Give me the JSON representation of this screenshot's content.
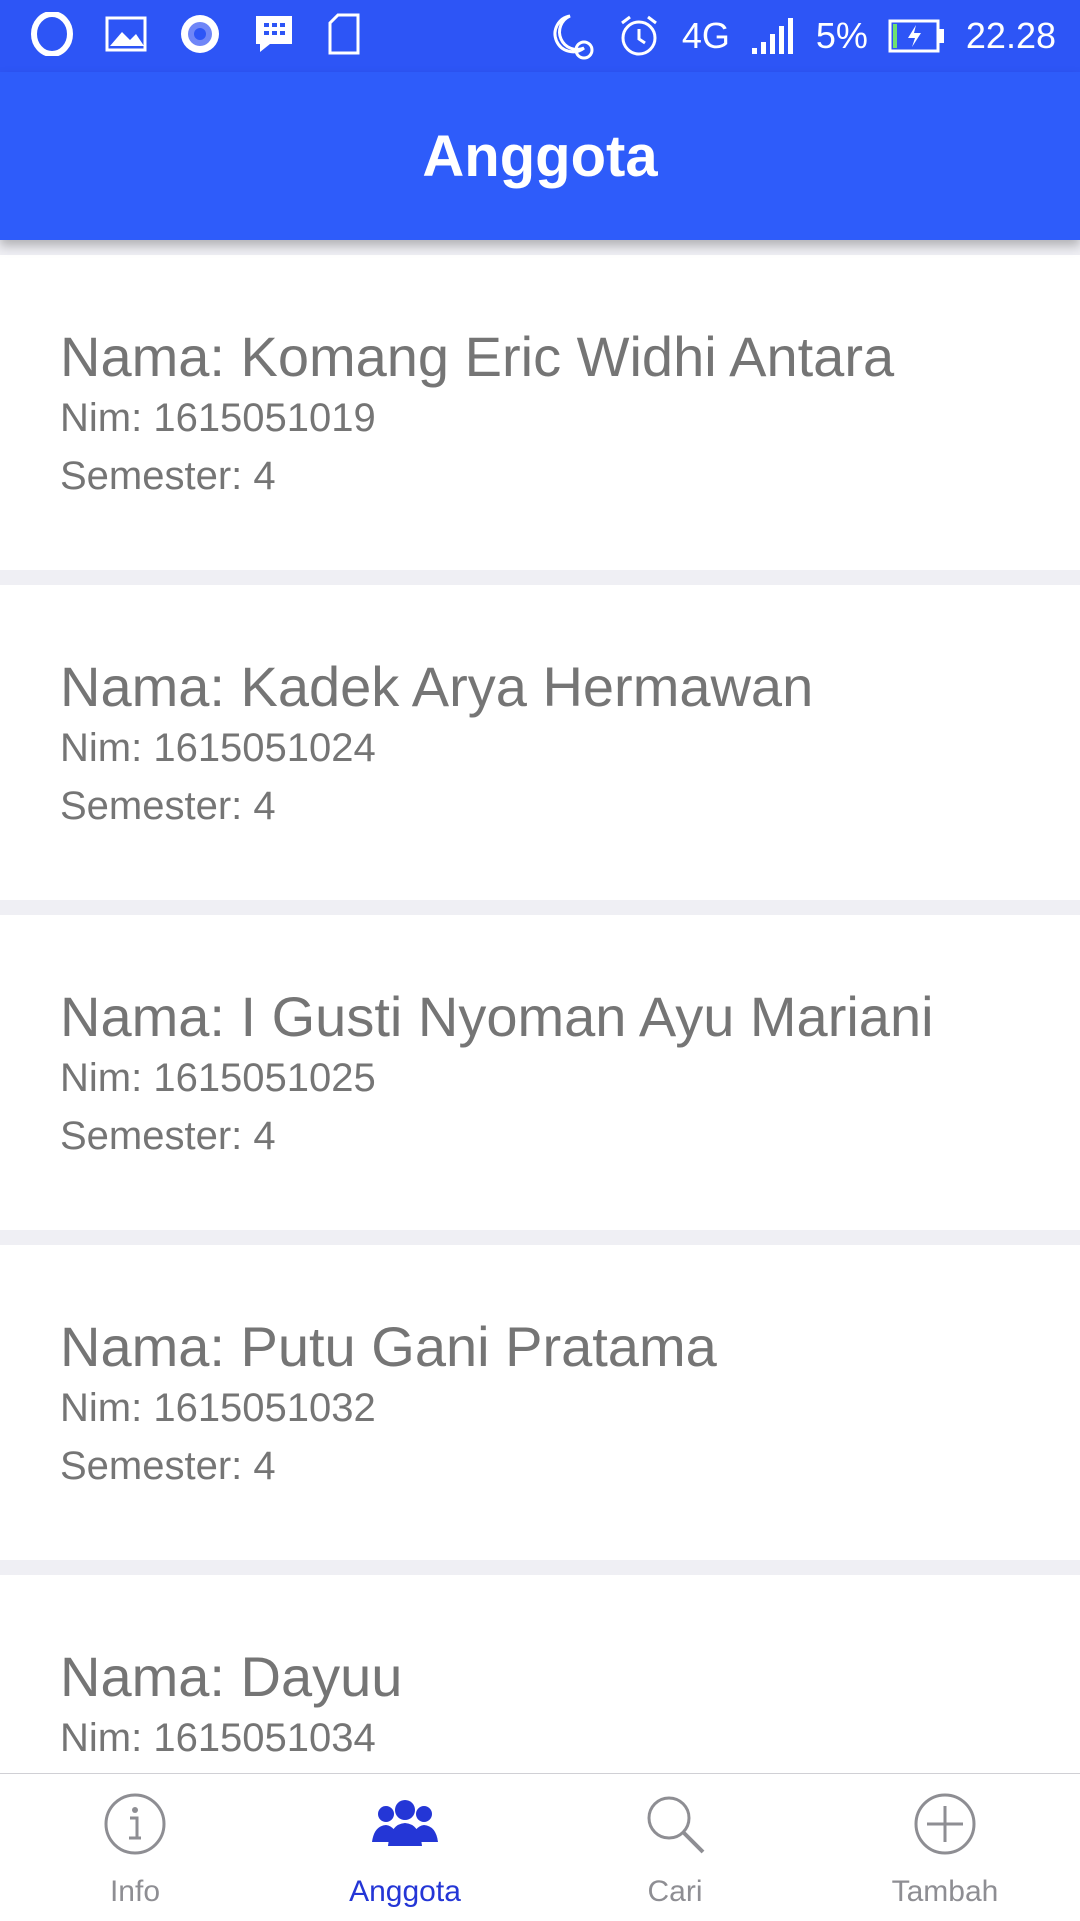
{
  "status_bar": {
    "left_icons": [
      "opera-icon",
      "gallery-icon",
      "record-icon",
      "bbm-icon",
      "sd-card-icon"
    ],
    "right_icons": [
      "do-not-disturb-alarm-icon",
      "alarm-icon"
    ],
    "network": "4G",
    "battery": "5%",
    "time": "22.28"
  },
  "header": {
    "title": "Anggota"
  },
  "members": [
    {
      "name": "Nama: Komang Eric Widhi Antara",
      "nim": "Nim: 1615051019",
      "semester": "Semester: 4"
    },
    {
      "name": "Nama: Kadek Arya Hermawan",
      "nim": "Nim: 1615051024",
      "semester": "Semester: 4"
    },
    {
      "name": "Nama: I Gusti Nyoman Ayu Mariani",
      "nim": "Nim: 1615051025",
      "semester": "Semester: 4"
    },
    {
      "name": "Nama: Putu Gani Pratama",
      "nim": "Nim: 1615051032",
      "semester": "Semester: 4"
    },
    {
      "name": "Nama: Dayuu",
      "nim": "Nim: 1615051034",
      "semester": ""
    }
  ],
  "tabs": [
    {
      "label": "Info",
      "icon": "info-icon",
      "active": false
    },
    {
      "label": "Anggota",
      "icon": "people-icon",
      "active": true
    },
    {
      "label": "Cari",
      "icon": "search-icon",
      "active": false
    },
    {
      "label": "Tambah",
      "icon": "add-circle-icon",
      "active": false
    }
  ],
  "colors": {
    "primary": "#2e5cfa",
    "active_tab": "#2436d6",
    "inactive_tab": "#8e8e93",
    "text": "#757575"
  }
}
